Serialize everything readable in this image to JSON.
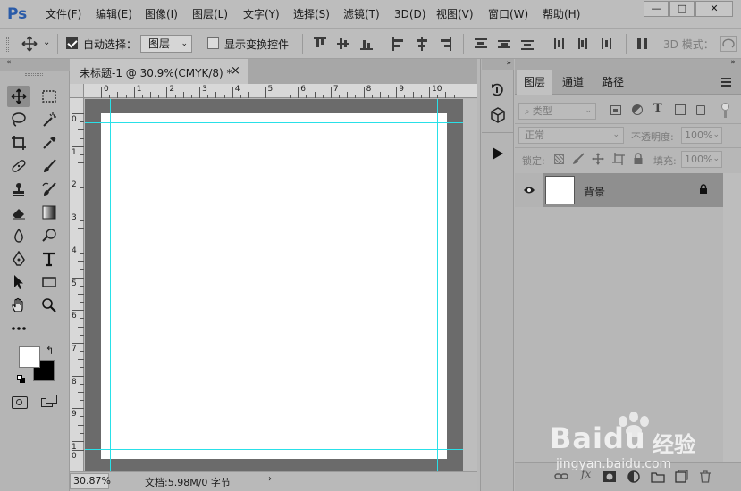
{
  "app": {
    "logo": "Ps"
  },
  "menu": [
    "文件(F)",
    "编辑(E)",
    "图像(I)",
    "图层(L)",
    "文字(Y)",
    "选择(S)",
    "滤镜(T)",
    "3D(D)",
    "视图(V)",
    "窗口(W)",
    "帮助(H)"
  ],
  "window_controls": {
    "minimize": "—",
    "maximize": "□",
    "close": "✕"
  },
  "options": {
    "auto_select_label": "自动选择：",
    "auto_select_value": "图层",
    "show_transform_label": "显示变换控件",
    "mode_3d_label": "3D 模式："
  },
  "document": {
    "tab_title": "未标题-1 @ 30.9%(CMYK/8) *",
    "tab_close": "×",
    "zoom": "30.87%",
    "doc_info": "文档:5.98M/0 字节"
  },
  "ruler": {
    "h_labels": [
      "0",
      "1",
      "2",
      "3",
      "4",
      "5",
      "6",
      "7",
      "8",
      "9",
      "10"
    ],
    "v_labels": [
      "0",
      "1",
      "2",
      "3",
      "4",
      "5",
      "6",
      "7",
      "8",
      "9",
      "1",
      "0"
    ]
  },
  "layers_panel": {
    "tabs": [
      "图层",
      "通道",
      "路径"
    ],
    "filter_placeholder": "类型",
    "blend_mode": "正常",
    "opacity_label": "不透明度:",
    "opacity_value": "100%",
    "lock_label": "锁定:",
    "fill_label": "填充:",
    "fill_value": "100%",
    "layers": [
      {
        "name": "背景",
        "visible": true,
        "locked": true
      }
    ]
  },
  "watermark": {
    "brand": "Baidu",
    "brand_cn": "经验",
    "url": "jingyan.baidu.com"
  },
  "colors": {
    "guide": "#29e0e8",
    "foreground": "#ffffff",
    "background": "#000000",
    "logo": "#2a5ba8"
  }
}
